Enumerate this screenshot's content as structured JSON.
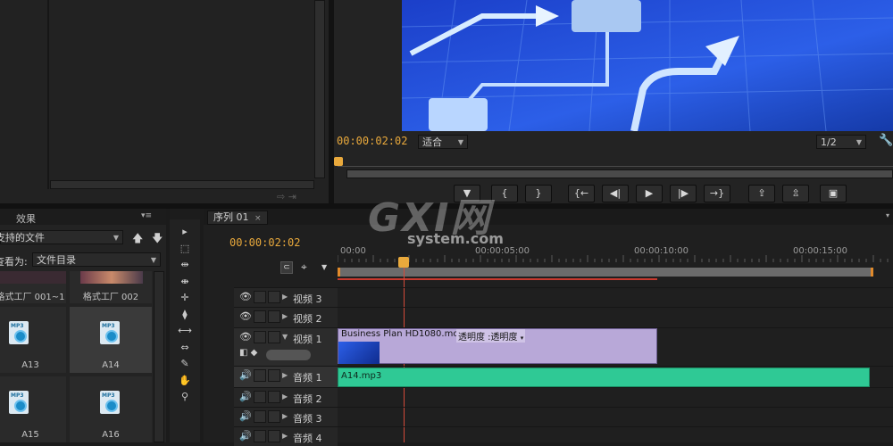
{
  "program_monitor": {
    "timecode": "00:00:02:02",
    "fit_dropdown": "适合",
    "quality_dropdown": "1/2",
    "playhead_marker_icon": "playhead-marker-icon",
    "transport": {
      "mark_in": "▼",
      "bracket_in": "{",
      "bracket_out": "}",
      "go_in": "{←",
      "step_back": "◀|",
      "play": "▶",
      "step_fwd": "|▶",
      "go_out": "→}",
      "lift": "⇪",
      "extract": "⇫",
      "export_frame": "▣"
    }
  },
  "watermark": {
    "brand": "GXI网",
    "site": "system.com"
  },
  "project_panel": {
    "tab_label": "效果",
    "filter_dropdown": "支持的文件",
    "view_label": "查看为:",
    "view_dropdown": "文件目录",
    "thumbs": [
      {
        "label": "格式工厂 001~1",
        "kind": "video"
      },
      {
        "label": "格式工厂 002",
        "kind": "video"
      },
      {
        "label": "A13",
        "kind": "mp3"
      },
      {
        "label": "A14",
        "kind": "mp3",
        "selected": true
      },
      {
        "label": "A15",
        "kind": "mp3"
      },
      {
        "label": "A16",
        "kind": "mp3"
      }
    ],
    "mp3_caption": "MP3"
  },
  "tools": [
    "▸",
    "⬚",
    "⇹",
    "⇼",
    "✛",
    "⧫",
    "⟷",
    "⇔",
    "✎",
    "✋",
    "⚲"
  ],
  "sequence": {
    "tab_label": "序列 01",
    "timecode": "00:00:02:02",
    "ruler": [
      "00:00",
      "00:00:05:00",
      "00:00:10:00",
      "00:00:15:00"
    ],
    "tracks": [
      {
        "name": "视频 3",
        "type": "video"
      },
      {
        "name": "视频 2",
        "type": "video"
      },
      {
        "name": "视频 1",
        "type": "video",
        "expanded": true
      },
      {
        "name": "音频 1",
        "type": "audio",
        "highlight": true
      },
      {
        "name": "音频 2",
        "type": "audio"
      },
      {
        "name": "音频 3",
        "type": "audio"
      },
      {
        "name": "音频 4",
        "type": "audio"
      }
    ],
    "video_clip": {
      "name": "Business Plan HD1080.mov",
      "effect": "透明度 :透明度"
    },
    "audio_clip": {
      "name": "A14.mp3"
    }
  },
  "colors": {
    "timecode": "#e9a93c",
    "video_clip": "#b8a8d8",
    "audio_clip": "#2fc995",
    "playhead": "#d44a3a"
  }
}
